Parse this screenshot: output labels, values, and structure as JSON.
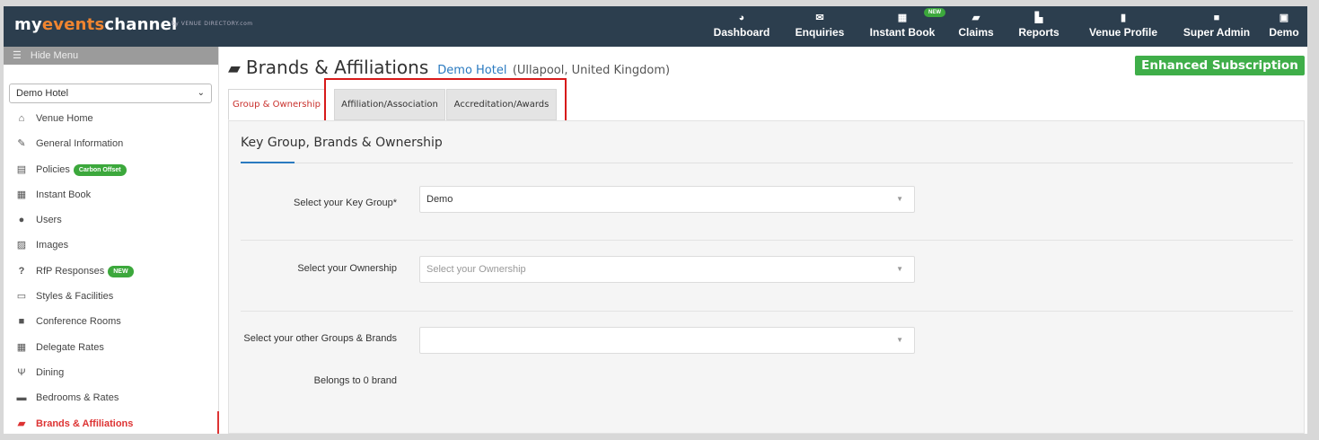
{
  "brand": {
    "logo_pre": "my",
    "logo_accent": "events",
    "logo_post": "channel",
    "logo_sub": "by VENUE DIRECTORY.com"
  },
  "nav": [
    {
      "label": "Dashboard",
      "icon": "dashboard-icon",
      "glyph": "◕"
    },
    {
      "label": "Enquiries",
      "icon": "envelope-icon",
      "glyph": "✉"
    },
    {
      "label": "Instant Book",
      "icon": "calendar-icon",
      "glyph": "▦",
      "badge": "NEW"
    },
    {
      "label": "Claims",
      "icon": "book-icon",
      "glyph": "▰"
    },
    {
      "label": "Reports",
      "icon": "bar-chart-icon",
      "glyph": "▙"
    },
    {
      "label": "Venue Profile",
      "icon": "building-icon",
      "glyph": "▮"
    },
    {
      "label": "Super Admin",
      "icon": "lock-icon",
      "glyph": "🔒"
    },
    {
      "label": "Demo",
      "icon": "user-icon",
      "glyph": "▣"
    }
  ],
  "sidebar": {
    "hide_menu": "Hide Menu",
    "venue": "Demo Hotel",
    "items": [
      {
        "label": "Venue Home",
        "icon": "home-icon",
        "glyph": "⌂"
      },
      {
        "label": "General Information",
        "icon": "edit-icon",
        "glyph": "✎"
      },
      {
        "label": "Policies",
        "icon": "document-icon",
        "glyph": "▤",
        "badge": "Carbon Offset"
      },
      {
        "label": "Instant Book",
        "icon": "calendar-icon",
        "glyph": "▦"
      },
      {
        "label": "Users",
        "icon": "user-icon",
        "glyph": "●"
      },
      {
        "label": "Images",
        "icon": "image-icon",
        "glyph": "▨"
      },
      {
        "label": "RfP Responses",
        "icon": "question-icon",
        "glyph": "?",
        "badge": "NEW"
      },
      {
        "label": "Styles & Facilities",
        "icon": "monitor-icon",
        "glyph": "▭"
      },
      {
        "label": "Conference Rooms",
        "icon": "briefcase-icon",
        "glyph": "■"
      },
      {
        "label": "Delegate Rates",
        "icon": "calculator-icon",
        "glyph": "▦"
      },
      {
        "label": "Dining",
        "icon": "cutlery-icon",
        "glyph": "Ψ"
      },
      {
        "label": "Bedrooms & Rates",
        "icon": "bed-icon",
        "glyph": "▬"
      },
      {
        "label": "Brands & Affiliations",
        "icon": "book-icon",
        "glyph": "▰",
        "active": true
      }
    ]
  },
  "header": {
    "title": "Brands & Affiliations",
    "hotel": "Demo Hotel",
    "location": "(Ullapool, United Kingdom)",
    "subscription": "Enhanced Subscription"
  },
  "tabs": [
    {
      "label": "Group & Ownership",
      "active": true
    },
    {
      "label": "Affiliation/Association"
    },
    {
      "label": "Accreditation/Awards"
    }
  ],
  "form": {
    "section_title": "Key Group, Brands & Ownership",
    "key_group_label": "Select your Key Group*",
    "key_group_value": "Demo",
    "ownership_label": "Select your Ownership",
    "ownership_placeholder": "Select your Ownership",
    "other_groups_label": "Select your other Groups & Brands",
    "other_groups_value": "",
    "belongs_text": "Belongs to 0 brand"
  },
  "colors": {
    "navbar": "#2c3e4e",
    "accent_orange": "#f08530",
    "green": "#3fae49",
    "active_red": "#c9302c",
    "link_blue": "#2a7ac0"
  }
}
